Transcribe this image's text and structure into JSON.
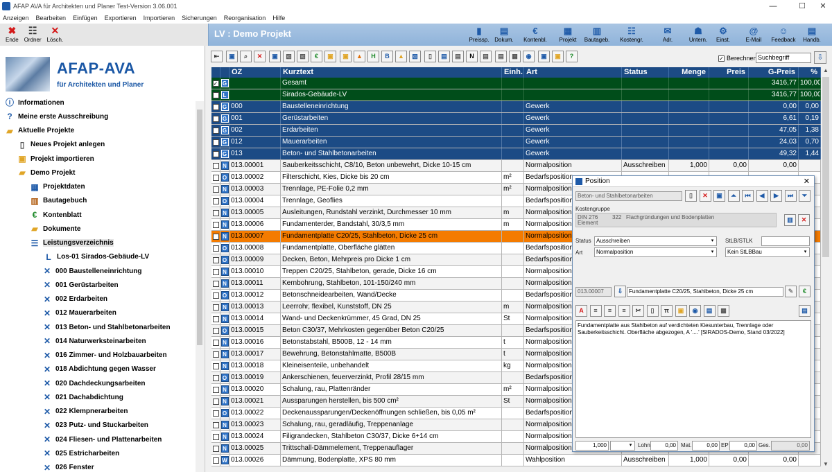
{
  "window": {
    "title": "AFAP AVA für Architekten und Planer Test-Version 3.06.001",
    "minimize": "—",
    "maximize": "☐",
    "close": "✕"
  },
  "menu": [
    "Anzeigen",
    "Bearbeiten",
    "Einfügen",
    "Exportieren",
    "Importieren",
    "Sicherungen",
    "Reorganisation",
    "Hilfe"
  ],
  "left_toolbar": [
    {
      "label": "Ende",
      "icon": "exit-icon",
      "glyph": "✖",
      "color": "#d41a1a"
    },
    {
      "label": "Ordner",
      "icon": "folder-tree-icon",
      "glyph": "☷",
      "color": "#333333"
    },
    {
      "label": "Lösch.",
      "icon": "delete-icon",
      "glyph": "✕",
      "color": "#d41a1a"
    }
  ],
  "banner": {
    "title": "LV : Demo Projekt"
  },
  "right_toolbar": [
    {
      "label": "Preissp.",
      "icon": "bar-chart-icon",
      "glyph": "▮"
    },
    {
      "label": "Dokum.",
      "icon": "document-icon",
      "glyph": "▤"
    },
    {
      "label": "Kontenbl.",
      "icon": "euro-icon",
      "glyph": "€"
    },
    {
      "label": "Projekt",
      "icon": "project-icon",
      "glyph": "▦"
    },
    {
      "label": "Bautageb.",
      "icon": "book-icon",
      "glyph": "▥"
    },
    {
      "label": "Kostengr.",
      "icon": "tree-icon",
      "glyph": "☷"
    },
    {
      "label": "Adr.",
      "icon": "mail-icon",
      "glyph": "✉"
    },
    {
      "label": "Untern.",
      "icon": "handshake-icon",
      "glyph": "☗"
    },
    {
      "label": "Einst.",
      "icon": "settings-icon",
      "glyph": "⚙"
    },
    {
      "label": "E-Mail",
      "icon": "email-icon",
      "glyph": "@"
    },
    {
      "label": "Feedback",
      "icon": "feedback-icon",
      "glyph": "☺"
    },
    {
      "label": "Handb.",
      "icon": "manual-icon",
      "glyph": "▤"
    }
  ],
  "logo": {
    "title": "AFAP-AVA",
    "subtitle": "für Architekten und Planer"
  },
  "tree": [
    {
      "label": "Informationen",
      "icon": "info-icon",
      "glyph": "ⓘ",
      "level": 0
    },
    {
      "label": "Meine erste Ausschreibung",
      "icon": "help-icon",
      "glyph": "?",
      "level": 0
    },
    {
      "label": "Aktuelle Projekte",
      "icon": "folder-open-icon",
      "glyph": "▰",
      "level": 0
    },
    {
      "label": "Neues Projekt anlegen",
      "icon": "new-document-icon",
      "glyph": "▯",
      "level": 1
    },
    {
      "label": "Projekt importieren",
      "icon": "import-icon",
      "glyph": "▣",
      "level": 1
    },
    {
      "label": "Demo Projekt",
      "icon": "folder-open-icon",
      "glyph": "▰",
      "level": 1
    },
    {
      "label": "Projektdaten",
      "icon": "project-data-icon",
      "glyph": "▦",
      "level": 2
    },
    {
      "label": "Bautagebuch",
      "icon": "book-icon",
      "glyph": "▥",
      "level": 2
    },
    {
      "label": "Kontenblatt",
      "icon": "euro-icon",
      "glyph": "€",
      "level": 2
    },
    {
      "label": "Dokumente",
      "icon": "folder-icon",
      "glyph": "▰",
      "level": 2
    },
    {
      "label": "Leistungsverzeichnis",
      "icon": "list-icon",
      "glyph": "☰",
      "level": 2,
      "selected": true
    },
    {
      "label": "Los-01  Sirados-Gebäude-LV",
      "icon": "lot-icon",
      "glyph": "L",
      "level": 3
    },
    {
      "label": "000 Baustelleneinrichtung",
      "icon": "tools-icon",
      "glyph": "✕",
      "level": 4
    },
    {
      "label": "001 Gerüstarbeiten",
      "icon": "tools-icon",
      "glyph": "✕",
      "level": 4
    },
    {
      "label": "002 Erdarbeiten",
      "icon": "tools-icon",
      "glyph": "✕",
      "level": 4
    },
    {
      "label": "012 Mauerarbeiten",
      "icon": "tools-icon",
      "glyph": "✕",
      "level": 4
    },
    {
      "label": "013 Beton- und Stahlbetonarbeiten",
      "icon": "tools-icon",
      "glyph": "✕",
      "level": 4
    },
    {
      "label": "014 Naturwerksteinarbeiten",
      "icon": "tools-icon",
      "glyph": "✕",
      "level": 4
    },
    {
      "label": "016 Zimmer- und Holzbauarbeiten",
      "icon": "tools-icon",
      "glyph": "✕",
      "level": 4
    },
    {
      "label": "018 Abdichtung gegen Wasser",
      "icon": "tools-icon",
      "glyph": "✕",
      "level": 4
    },
    {
      "label": "020 Dachdeckungsarbeiten",
      "icon": "tools-icon",
      "glyph": "✕",
      "level": 4
    },
    {
      "label": "021 Dachabdichtung",
      "icon": "tools-icon",
      "glyph": "✕",
      "level": 4
    },
    {
      "label": "022 Klempnerarbeiten",
      "icon": "tools-icon",
      "glyph": "✕",
      "level": 4
    },
    {
      "label": "023 Putz- und Stuckarbeiten",
      "icon": "tools-icon",
      "glyph": "✕",
      "level": 4
    },
    {
      "label": "024 Fliesen- und Plattenarbeiten",
      "icon": "tools-icon",
      "glyph": "✕",
      "level": 4
    },
    {
      "label": "025 Estricharbeiten",
      "icon": "tools-icon",
      "glyph": "✕",
      "level": 4
    },
    {
      "label": "026 Fenster",
      "icon": "tools-icon",
      "glyph": "✕",
      "level": 4
    }
  ],
  "lv_toolbar": [
    "⇤",
    "▣",
    "⌕",
    "✕",
    "▣",
    "▧",
    "▧",
    "€",
    "▣",
    "▣",
    "▲",
    "H",
    "B",
    "▲",
    "▧",
    "▯",
    "▤",
    "▤",
    "N",
    "▤",
    "▤",
    "▦",
    "◉",
    "▣",
    "▣",
    "?"
  ],
  "berechnen": {
    "label": "Berechnen",
    "checked": "✓"
  },
  "search": {
    "value": "Suchbegriff",
    "go": "⇩"
  },
  "grid": {
    "headers": {
      "oz": "OZ",
      "kurztext": "Kurztext",
      "einh": "Einh.",
      "art": "Art",
      "status": "Status",
      "menge": "Menge",
      "preis": "Preis",
      "gpreis": "G-Preis",
      "pct": "%"
    },
    "rows": [
      {
        "kind": "total",
        "chk": "✓",
        "typ": "G",
        "oz": "",
        "kurztext": "Gesamt",
        "einh": "",
        "art": "",
        "status": "",
        "menge": "",
        "preis": "",
        "gpreis": "3416,77",
        "pct": "100,00"
      },
      {
        "kind": "total",
        "chk": "",
        "typ": "L",
        "oz": "",
        "kurztext": "Sirados-Gebäude-LV",
        "einh": "",
        "art": "",
        "status": "",
        "menge": "",
        "preis": "",
        "gpreis": "3416,77",
        "pct": "100,00"
      },
      {
        "kind": "group",
        "chk": "",
        "typ": "G",
        "oz": "000",
        "kurztext": "Baustelleneinrichtung",
        "einh": "",
        "art": "Gewerk",
        "status": "",
        "menge": "",
        "preis": "",
        "gpreis": "0,00",
        "pct": "0,00"
      },
      {
        "kind": "group",
        "chk": "",
        "typ": "G",
        "oz": "001",
        "kurztext": "Gerüstarbeiten",
        "einh": "",
        "art": "Gewerk",
        "status": "",
        "menge": "",
        "preis": "",
        "gpreis": "6,61",
        "pct": "0,19"
      },
      {
        "kind": "group",
        "chk": "",
        "typ": "G",
        "oz": "002",
        "kurztext": "Erdarbeiten",
        "einh": "",
        "art": "Gewerk",
        "status": "",
        "menge": "",
        "preis": "",
        "gpreis": "47,05",
        "pct": "1,38"
      },
      {
        "kind": "group",
        "chk": "",
        "typ": "G",
        "oz": "012",
        "kurztext": "Mauerarbeiten",
        "einh": "",
        "art": "Gewerk",
        "status": "",
        "menge": "",
        "preis": "",
        "gpreis": "24,03",
        "pct": "0,70"
      },
      {
        "kind": "group",
        "chk": "",
        "typ": "G",
        "oz": "013",
        "kurztext": "Beton- und Stahlbetonarbeiten",
        "einh": "",
        "art": "Gewerk",
        "status": "",
        "menge": "",
        "preis": "",
        "gpreis": "49,32",
        "pct": "1,44"
      },
      {
        "kind": "pos",
        "chk": "",
        "typ": "N",
        "oz": "013.00001",
        "kurztext": "Sauberkeitsschicht, C8/10, Beton unbewehrt, Dicke 10-15 cm",
        "einh": "",
        "art": "Normalposition",
        "status": "Ausschreiben",
        "menge": "1,000",
        "preis": "0,00",
        "gpreis": "0,00",
        "pct": ""
      },
      {
        "kind": "pos",
        "chk": "",
        "typ": "O",
        "oz": "013.00002",
        "kurztext": "Filterschicht, Kies, Dicke bis 20 cm",
        "einh": "m²",
        "art": "Bedarfsposition",
        "status": "",
        "menge": "",
        "preis": "",
        "gpreis": "",
        "pct": ""
      },
      {
        "kind": "pos",
        "chk": "",
        "typ": "N",
        "oz": "013.00003",
        "kurztext": "Trennlage, PE-Folie 0,2 mm",
        "einh": "m²",
        "art": "Normalposition",
        "status": "",
        "menge": "",
        "preis": "",
        "gpreis": "",
        "pct": ""
      },
      {
        "kind": "pos",
        "chk": "",
        "typ": "O",
        "oz": "013.00004",
        "kurztext": "Trennlage, Geoflies",
        "einh": "",
        "art": "Bedarfsposition",
        "status": "",
        "menge": "",
        "preis": "",
        "gpreis": "",
        "pct": ""
      },
      {
        "kind": "pos",
        "chk": "",
        "typ": "N",
        "oz": "013.00005",
        "kurztext": "Ausleitungen, Rundstahl verzinkt, Durchmesser 10 mm",
        "einh": "m",
        "art": "Normalposition",
        "status": "",
        "menge": "",
        "preis": "",
        "gpreis": "",
        "pct": ""
      },
      {
        "kind": "pos",
        "chk": "",
        "typ": "N",
        "oz": "013.00006",
        "kurztext": "Fundamenterder, Bandstahl, 30/3,5 mm",
        "einh": "m",
        "art": "Normalposition",
        "status": "",
        "menge": "",
        "preis": "",
        "gpreis": "",
        "pct": ""
      },
      {
        "kind": "sel",
        "chk": "",
        "typ": "N",
        "oz": "013.00007",
        "kurztext": "Fundamentplatte C20/25, Stahlbeton, Dicke 25 cm",
        "einh": "",
        "art": "Normalposition",
        "status": "",
        "menge": "",
        "preis": "",
        "gpreis": "",
        "pct": ""
      },
      {
        "kind": "pos",
        "chk": "",
        "typ": "O",
        "oz": "013.00008",
        "kurztext": "Fundamentplatte, Oberfläche glätten",
        "einh": "",
        "art": "Bedarfsposition",
        "status": "",
        "menge": "",
        "preis": "",
        "gpreis": "",
        "pct": ""
      },
      {
        "kind": "pos",
        "chk": "",
        "typ": "O",
        "oz": "013.00009",
        "kurztext": "Decken, Beton, Mehrpreis pro Dicke 1 cm",
        "einh": "",
        "art": "Bedarfsposition",
        "status": "",
        "menge": "",
        "preis": "",
        "gpreis": "",
        "pct": ""
      },
      {
        "kind": "pos",
        "chk": "",
        "typ": "N",
        "oz": "013.00010",
        "kurztext": "Treppen C20/25, Stahlbeton, gerade, Dicke 16 cm",
        "einh": "",
        "art": "Normalposition",
        "status": "",
        "menge": "",
        "preis": "",
        "gpreis": "",
        "pct": ""
      },
      {
        "kind": "pos",
        "chk": "",
        "typ": "N",
        "oz": "013.00011",
        "kurztext": "Kernbohrung, Stahlbeton, 101-150/240 mm",
        "einh": "",
        "art": "Normalposition",
        "status": "",
        "menge": "",
        "preis": "",
        "gpreis": "",
        "pct": ""
      },
      {
        "kind": "pos",
        "chk": "",
        "typ": "O",
        "oz": "013.00012",
        "kurztext": "Betonschneidearbeiten, Wand/Decke",
        "einh": "",
        "art": "Bedarfsposition",
        "status": "",
        "menge": "",
        "preis": "",
        "gpreis": "",
        "pct": ""
      },
      {
        "kind": "pos",
        "chk": "",
        "typ": "N",
        "oz": "013.00013",
        "kurztext": "Leerrohr, flexibel, Kunststoff, DN 25",
        "einh": "m",
        "art": "Normalposition",
        "status": "",
        "menge": "",
        "preis": "",
        "gpreis": "",
        "pct": ""
      },
      {
        "kind": "pos",
        "chk": "",
        "typ": "N",
        "oz": "013.00014",
        "kurztext": "Wand- und Deckenkrümmer, 45 Grad, DN 25",
        "einh": "St",
        "art": "Normalposition",
        "status": "",
        "menge": "",
        "preis": "",
        "gpreis": "",
        "pct": ""
      },
      {
        "kind": "pos",
        "chk": "",
        "typ": "O",
        "oz": "013.00015",
        "kurztext": "Beton C30/37, Mehrkosten gegenüber Beton C20/25",
        "einh": "",
        "art": "Bedarfsposition",
        "status": "",
        "menge": "",
        "preis": "",
        "gpreis": "",
        "pct": ""
      },
      {
        "kind": "pos",
        "chk": "",
        "typ": "N",
        "oz": "013.00016",
        "kurztext": "Betonstabstahl, B500B, 12 - 14 mm",
        "einh": "t",
        "art": "Normalposition",
        "status": "",
        "menge": "",
        "preis": "",
        "gpreis": "",
        "pct": ""
      },
      {
        "kind": "pos",
        "chk": "",
        "typ": "N",
        "oz": "013.00017",
        "kurztext": "Bewehrung, Betonstahlmatte, B500B",
        "einh": "t",
        "art": "Normalposition",
        "status": "",
        "menge": "",
        "preis": "",
        "gpreis": "",
        "pct": ""
      },
      {
        "kind": "pos",
        "chk": "",
        "typ": "N",
        "oz": "013.00018",
        "kurztext": "Kleineisenteile, unbehandelt",
        "einh": "kg",
        "art": "Normalposition",
        "status": "",
        "menge": "",
        "preis": "",
        "gpreis": "",
        "pct": ""
      },
      {
        "kind": "pos",
        "chk": "",
        "typ": "O",
        "oz": "013.00019",
        "kurztext": "Ankerschienen, feuerverzinkt, Profil 28/15 mm",
        "einh": "",
        "art": "Bedarfsposition",
        "status": "",
        "menge": "",
        "preis": "",
        "gpreis": "",
        "pct": ""
      },
      {
        "kind": "pos",
        "chk": "",
        "typ": "N",
        "oz": "013.00020",
        "kurztext": "Schalung, rau, Plattenränder",
        "einh": "m²",
        "art": "Normalposition",
        "status": "",
        "menge": "",
        "preis": "",
        "gpreis": "",
        "pct": ""
      },
      {
        "kind": "pos",
        "chk": "",
        "typ": "N",
        "oz": "013.00021",
        "kurztext": "Aussparungen herstellen, bis 500 cm²",
        "einh": "St",
        "art": "Normalposition",
        "status": "",
        "menge": "",
        "preis": "",
        "gpreis": "",
        "pct": ""
      },
      {
        "kind": "pos",
        "chk": "",
        "typ": "O",
        "oz": "013.00022",
        "kurztext": "Deckenaussparungen/Deckenöffnungen schließen, bis 0,05 m²",
        "einh": "",
        "art": "Bedarfsposition",
        "status": "",
        "menge": "",
        "preis": "",
        "gpreis": "",
        "pct": ""
      },
      {
        "kind": "pos",
        "chk": "",
        "typ": "N",
        "oz": "013.00023",
        "kurztext": "Schalung, rau, geradläufig, Treppenanlage",
        "einh": "",
        "art": "Normalposition",
        "status": "",
        "menge": "",
        "preis": "",
        "gpreis": "",
        "pct": ""
      },
      {
        "kind": "pos",
        "chk": "",
        "typ": "N",
        "oz": "013.00024",
        "kurztext": "Filigrandecken, Stahlbeton C30/37, Dicke 6+14 cm",
        "einh": "",
        "art": "Normalposition",
        "status": "",
        "menge": "",
        "preis": "",
        "gpreis": "",
        "pct": ""
      },
      {
        "kind": "pos",
        "chk": "",
        "typ": "N",
        "oz": "013.00025",
        "kurztext": "Trittschall-Dämmelement, Treppenauflager",
        "einh": "",
        "art": "Normalposition",
        "status": "",
        "menge": "",
        "preis": "",
        "gpreis": "",
        "pct": ""
      },
      {
        "kind": "pos",
        "chk": "",
        "typ": "W",
        "oz": "013.00026",
        "kurztext": "Dämmung, Bodenplatte, XPS 80 mm",
        "einh": "",
        "art": "Wahlposition",
        "status": "Ausschreiben",
        "menge": "1,000",
        "preis": "0,00",
        "gpreis": "0,00",
        "pct": ""
      }
    ]
  },
  "dialog": {
    "title": "Position",
    "close": "✕",
    "parent": "Beton- und Stahlbetonarbeiten",
    "nav_buttons": [
      "▯",
      "✕",
      "▣",
      "⏶",
      "⏮",
      "◀",
      "▶",
      "⏭",
      "⏷"
    ],
    "kostengruppe_label": "Kostengruppe",
    "din": "DIN 276",
    "element": "Element",
    "kg_code": "322",
    "kg_text": "Flachgründungen und Bodenplatten",
    "status_label": "Status",
    "status_value": "Ausschreiben",
    "stlb_label": "StLB/STLK",
    "stlb_value": "",
    "art_label": "Art",
    "art_value": "Normalposition",
    "stlbbau_value": "Kein StLBBau",
    "oz_value": "013.00007",
    "kurztext_value": "Fundamentplatte C20/25, Stahlbeton, Dicke 25 cm",
    "format_buttons": [
      "A",
      "≡",
      "≡",
      "≡",
      "✂",
      "▯",
      "π",
      "▣",
      "◉",
      "▤",
      "▦"
    ],
    "langtext": "Fundamentplatte aus Stahlbeton auf verdichteten Kiesunterbau, Trennlage oder Sauberkeitsschicht. Oberfläche abgezogen, A '....' [SIRADOS-Demo, Stand 03/2022]",
    "menge": "1,000",
    "lohn_label": "Lohn",
    "lohn": "0,00",
    "mat_label": "Mat.",
    "mat": "0,00",
    "ep_label": "EP",
    "ep": "0,00",
    "ges_label": "Ges.",
    "ges": "0,00"
  }
}
